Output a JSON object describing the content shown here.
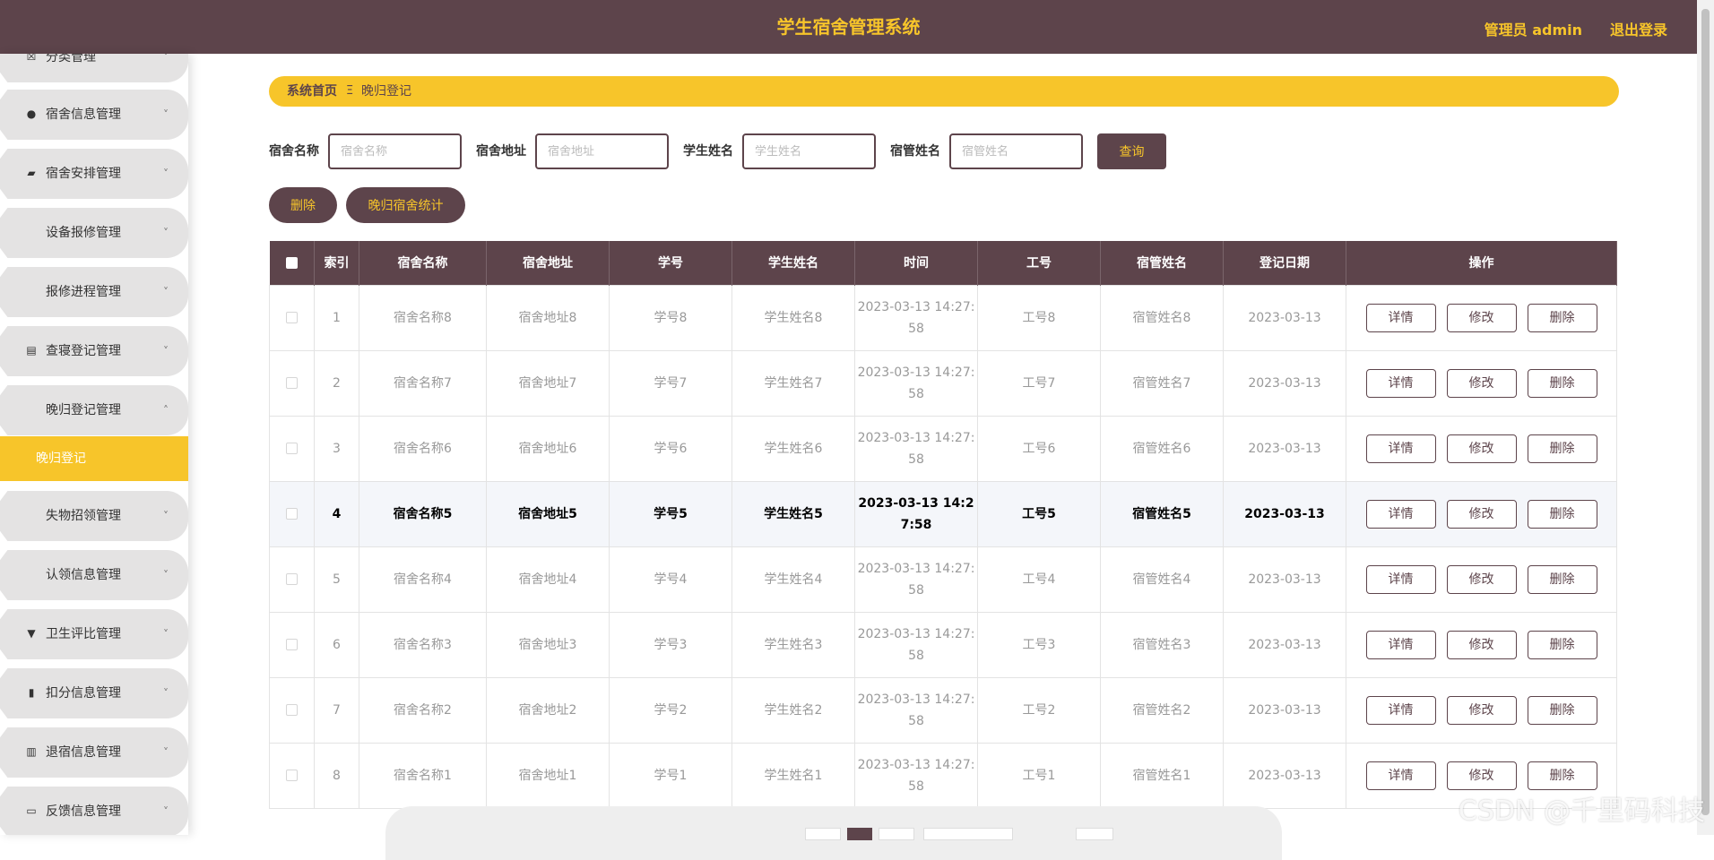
{
  "header": {
    "title": "学生宿舍管理系统",
    "user_label": "管理员 admin",
    "logout_label": "退出登录"
  },
  "colors": {
    "primary": "#5d444b",
    "accent": "#f7c52a"
  },
  "sidebar": {
    "items": [
      {
        "label": "分类管理",
        "icon": "list-icon",
        "chevron": "˅"
      },
      {
        "label": "宿舍信息管理",
        "icon": "location-pin-icon",
        "chevron": "˅"
      },
      {
        "label": "宿舍安排管理",
        "icon": "wallet-icon",
        "chevron": "˅"
      },
      {
        "label": "设备报修管理",
        "icon": "grid-icon",
        "chevron": "˅"
      },
      {
        "label": "报修进程管理",
        "icon": "grid-icon",
        "chevron": "˅"
      },
      {
        "label": "查寝登记管理",
        "icon": "clipboard-icon",
        "chevron": "˅"
      },
      {
        "label": "晚归登记管理",
        "icon": "grid-icon",
        "chevron": "˄"
      },
      {
        "label": "失物招领管理",
        "icon": "grid-icon",
        "chevron": "˅"
      },
      {
        "label": "认领信息管理",
        "icon": "grid-icon",
        "chevron": "˅"
      },
      {
        "label": "卫生评比管理",
        "icon": "trophy-icon",
        "chevron": "˅"
      },
      {
        "label": "扣分信息管理",
        "icon": "bar-chart-icon",
        "chevron": "˅"
      },
      {
        "label": "退宿信息管理",
        "icon": "book-icon",
        "chevron": "˅"
      },
      {
        "label": "反馈信息管理",
        "icon": "message-icon",
        "chevron": "˅"
      }
    ],
    "active_sub": "晚归登记"
  },
  "breadcrumb": {
    "home": "系统首页",
    "separator": "Ξ",
    "current": "晚归登记"
  },
  "search": {
    "dorm_name_label": "宿舍名称",
    "dorm_name_placeholder": "宿舍名称",
    "dorm_addr_label": "宿舍地址",
    "dorm_addr_placeholder": "宿舍地址",
    "student_name_label": "学生姓名",
    "student_name_placeholder": "学生姓名",
    "manager_name_label": "宿管姓名",
    "manager_name_placeholder": "宿管姓名",
    "query_label": "查询"
  },
  "toolbar": {
    "delete_label": "删除",
    "stats_label": "晚归宿舍统计"
  },
  "table": {
    "columns": [
      "",
      "索引",
      "宿舍名称",
      "宿舍地址",
      "学号",
      "学生姓名",
      "时间",
      "工号",
      "宿管姓名",
      "登记日期",
      "操作"
    ],
    "rows": [
      {
        "index": "1",
        "dorm_name": "宿舍名称8",
        "dorm_addr": "宿舍地址8",
        "student_id": "学号8",
        "student_name": "学生姓名8",
        "time": "2023-03-13 14:27:58",
        "staff_id": "工号8",
        "manager_name": "宿管姓名8",
        "date": "2023-03-13"
      },
      {
        "index": "2",
        "dorm_name": "宿舍名称7",
        "dorm_addr": "宿舍地址7",
        "student_id": "学号7",
        "student_name": "学生姓名7",
        "time": "2023-03-13 14:27:58",
        "staff_id": "工号7",
        "manager_name": "宿管姓名7",
        "date": "2023-03-13"
      },
      {
        "index": "3",
        "dorm_name": "宿舍名称6",
        "dorm_addr": "宿舍地址6",
        "student_id": "学号6",
        "student_name": "学生姓名6",
        "time": "2023-03-13 14:27:58",
        "staff_id": "工号6",
        "manager_name": "宿管姓名6",
        "date": "2023-03-13"
      },
      {
        "index": "4",
        "dorm_name": "宿舍名称5",
        "dorm_addr": "宿舍地址5",
        "student_id": "学号5",
        "student_name": "学生姓名5",
        "time": "2023-03-13 14:27:58",
        "staff_id": "工号5",
        "manager_name": "宿管姓名5",
        "date": "2023-03-13"
      },
      {
        "index": "5",
        "dorm_name": "宿舍名称4",
        "dorm_addr": "宿舍地址4",
        "student_id": "学号4",
        "student_name": "学生姓名4",
        "time": "2023-03-13 14:27:58",
        "staff_id": "工号4",
        "manager_name": "宿管姓名4",
        "date": "2023-03-13"
      },
      {
        "index": "6",
        "dorm_name": "宿舍名称3",
        "dorm_addr": "宿舍地址3",
        "student_id": "学号3",
        "student_name": "学生姓名3",
        "time": "2023-03-13 14:27:58",
        "staff_id": "工号3",
        "manager_name": "宿管姓名3",
        "date": "2023-03-13"
      },
      {
        "index": "7",
        "dorm_name": "宿舍名称2",
        "dorm_addr": "宿舍地址2",
        "student_id": "学号2",
        "student_name": "学生姓名2",
        "time": "2023-03-13 14:27:58",
        "staff_id": "工号2",
        "manager_name": "宿管姓名2",
        "date": "2023-03-13"
      },
      {
        "index": "8",
        "dorm_name": "宿舍名称1",
        "dorm_addr": "宿舍地址1",
        "student_id": "学号1",
        "student_name": "学生姓名1",
        "time": "2023-03-13 14:27:58",
        "staff_id": "工号1",
        "manager_name": "宿管姓名1",
        "date": "2023-03-13"
      }
    ],
    "actions": {
      "detail": "详情",
      "edit": "修改",
      "delete": "删除"
    }
  },
  "watermark": "CSDN @千里码科技"
}
